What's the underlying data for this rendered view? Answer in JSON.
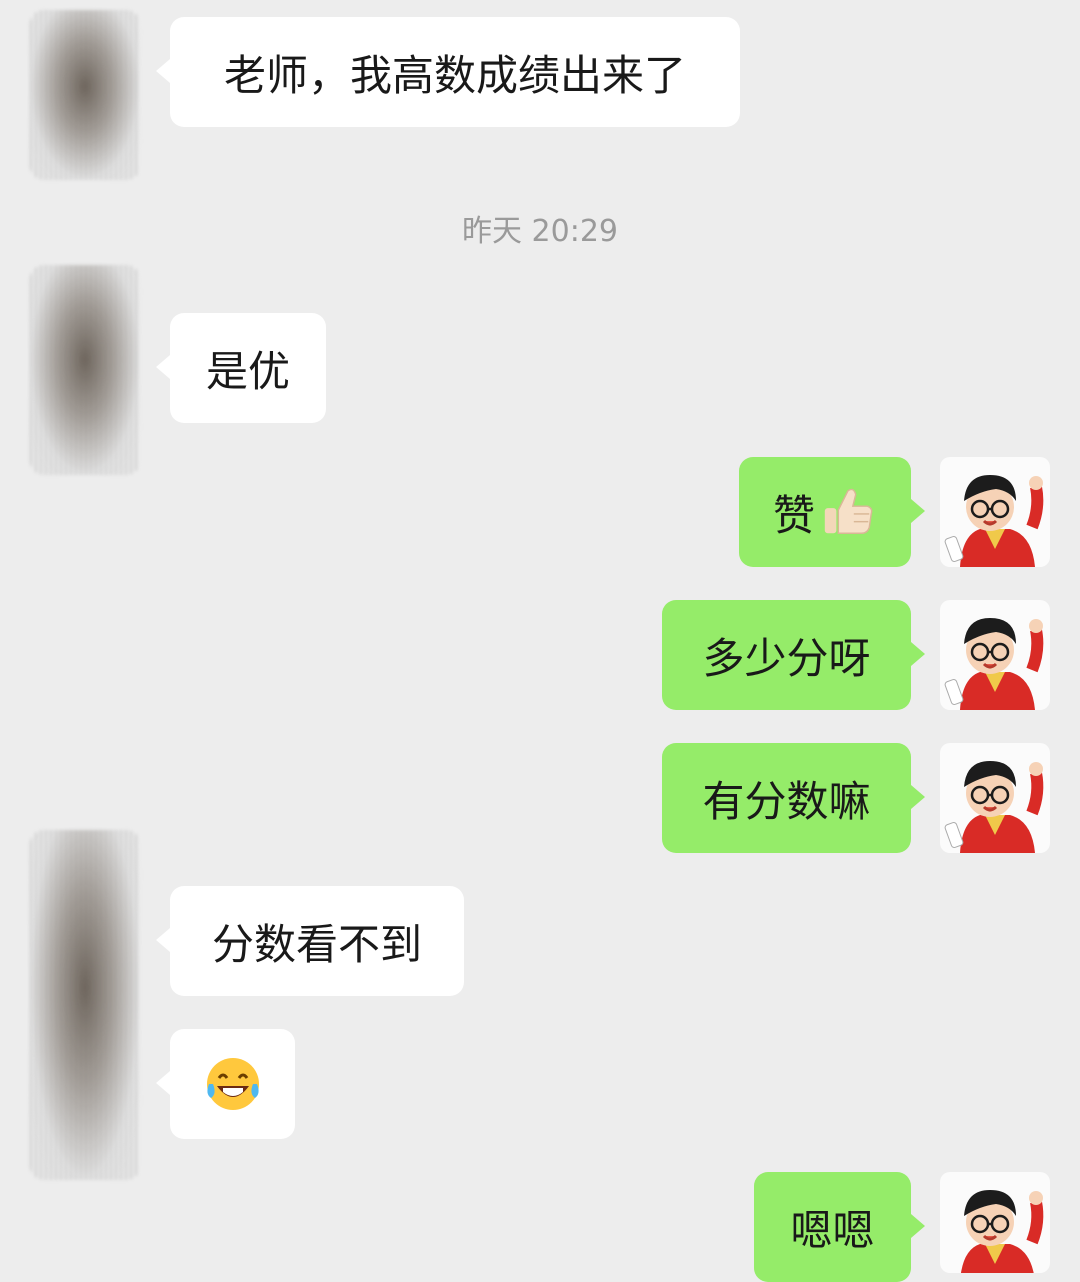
{
  "timestamp": "昨天 20:29",
  "messages": [
    {
      "side": "left",
      "text": "老师，我高数成绩出来了"
    },
    {
      "side": "left",
      "text": "是优"
    },
    {
      "side": "right",
      "text": "赞",
      "emoji": "thumbs-up-icon"
    },
    {
      "side": "right",
      "text": "多少分呀"
    },
    {
      "side": "right",
      "text": "有分数嘛"
    },
    {
      "side": "left",
      "text": "分数看不到"
    },
    {
      "side": "left",
      "emoji": "laughing-tears-icon"
    },
    {
      "side": "right",
      "text": "嗯嗯"
    }
  ],
  "colors": {
    "background": "#ededed",
    "left_bubble": "#ffffff",
    "right_bubble": "#95ec69",
    "timestamp_text": "#9a9a9a"
  }
}
